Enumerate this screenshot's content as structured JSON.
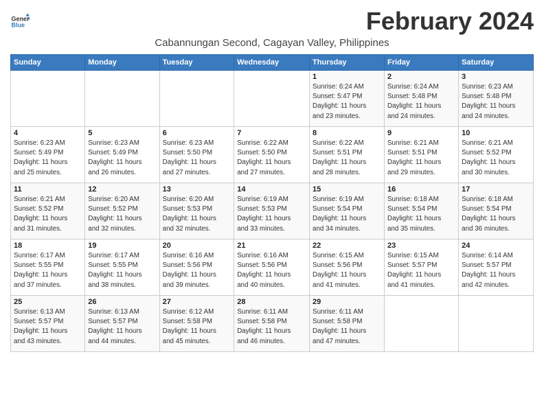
{
  "logo": {
    "line1": "General",
    "line2": "Blue"
  },
  "title": "February 2024",
  "location": "Cabannungan Second, Cagayan Valley, Philippines",
  "weekdays": [
    "Sunday",
    "Monday",
    "Tuesday",
    "Wednesday",
    "Thursday",
    "Friday",
    "Saturday"
  ],
  "weeks": [
    [
      {
        "day": "",
        "info": ""
      },
      {
        "day": "",
        "info": ""
      },
      {
        "day": "",
        "info": ""
      },
      {
        "day": "",
        "info": ""
      },
      {
        "day": "1",
        "info": "Sunrise: 6:24 AM\nSunset: 5:47 PM\nDaylight: 11 hours\nand 23 minutes."
      },
      {
        "day": "2",
        "info": "Sunrise: 6:24 AM\nSunset: 5:48 PM\nDaylight: 11 hours\nand 24 minutes."
      },
      {
        "day": "3",
        "info": "Sunrise: 6:23 AM\nSunset: 5:48 PM\nDaylight: 11 hours\nand 24 minutes."
      }
    ],
    [
      {
        "day": "4",
        "info": "Sunrise: 6:23 AM\nSunset: 5:49 PM\nDaylight: 11 hours\nand 25 minutes."
      },
      {
        "day": "5",
        "info": "Sunrise: 6:23 AM\nSunset: 5:49 PM\nDaylight: 11 hours\nand 26 minutes."
      },
      {
        "day": "6",
        "info": "Sunrise: 6:23 AM\nSunset: 5:50 PM\nDaylight: 11 hours\nand 27 minutes."
      },
      {
        "day": "7",
        "info": "Sunrise: 6:22 AM\nSunset: 5:50 PM\nDaylight: 11 hours\nand 27 minutes."
      },
      {
        "day": "8",
        "info": "Sunrise: 6:22 AM\nSunset: 5:51 PM\nDaylight: 11 hours\nand 28 minutes."
      },
      {
        "day": "9",
        "info": "Sunrise: 6:21 AM\nSunset: 5:51 PM\nDaylight: 11 hours\nand 29 minutes."
      },
      {
        "day": "10",
        "info": "Sunrise: 6:21 AM\nSunset: 5:52 PM\nDaylight: 11 hours\nand 30 minutes."
      }
    ],
    [
      {
        "day": "11",
        "info": "Sunrise: 6:21 AM\nSunset: 5:52 PM\nDaylight: 11 hours\nand 31 minutes."
      },
      {
        "day": "12",
        "info": "Sunrise: 6:20 AM\nSunset: 5:52 PM\nDaylight: 11 hours\nand 32 minutes."
      },
      {
        "day": "13",
        "info": "Sunrise: 6:20 AM\nSunset: 5:53 PM\nDaylight: 11 hours\nand 32 minutes."
      },
      {
        "day": "14",
        "info": "Sunrise: 6:19 AM\nSunset: 5:53 PM\nDaylight: 11 hours\nand 33 minutes."
      },
      {
        "day": "15",
        "info": "Sunrise: 6:19 AM\nSunset: 5:54 PM\nDaylight: 11 hours\nand 34 minutes."
      },
      {
        "day": "16",
        "info": "Sunrise: 6:18 AM\nSunset: 5:54 PM\nDaylight: 11 hours\nand 35 minutes."
      },
      {
        "day": "17",
        "info": "Sunrise: 6:18 AM\nSunset: 5:54 PM\nDaylight: 11 hours\nand 36 minutes."
      }
    ],
    [
      {
        "day": "18",
        "info": "Sunrise: 6:17 AM\nSunset: 5:55 PM\nDaylight: 11 hours\nand 37 minutes."
      },
      {
        "day": "19",
        "info": "Sunrise: 6:17 AM\nSunset: 5:55 PM\nDaylight: 11 hours\nand 38 minutes."
      },
      {
        "day": "20",
        "info": "Sunrise: 6:16 AM\nSunset: 5:56 PM\nDaylight: 11 hours\nand 39 minutes."
      },
      {
        "day": "21",
        "info": "Sunrise: 6:16 AM\nSunset: 5:56 PM\nDaylight: 11 hours\nand 40 minutes."
      },
      {
        "day": "22",
        "info": "Sunrise: 6:15 AM\nSunset: 5:56 PM\nDaylight: 11 hours\nand 41 minutes."
      },
      {
        "day": "23",
        "info": "Sunrise: 6:15 AM\nSunset: 5:57 PM\nDaylight: 11 hours\nand 41 minutes."
      },
      {
        "day": "24",
        "info": "Sunrise: 6:14 AM\nSunset: 5:57 PM\nDaylight: 11 hours\nand 42 minutes."
      }
    ],
    [
      {
        "day": "25",
        "info": "Sunrise: 6:13 AM\nSunset: 5:57 PM\nDaylight: 11 hours\nand 43 minutes."
      },
      {
        "day": "26",
        "info": "Sunrise: 6:13 AM\nSunset: 5:57 PM\nDaylight: 11 hours\nand 44 minutes."
      },
      {
        "day": "27",
        "info": "Sunrise: 6:12 AM\nSunset: 5:58 PM\nDaylight: 11 hours\nand 45 minutes."
      },
      {
        "day": "28",
        "info": "Sunrise: 6:11 AM\nSunset: 5:58 PM\nDaylight: 11 hours\nand 46 minutes."
      },
      {
        "day": "29",
        "info": "Sunrise: 6:11 AM\nSunset: 5:58 PM\nDaylight: 11 hours\nand 47 minutes."
      },
      {
        "day": "",
        "info": ""
      },
      {
        "day": "",
        "info": ""
      }
    ]
  ]
}
